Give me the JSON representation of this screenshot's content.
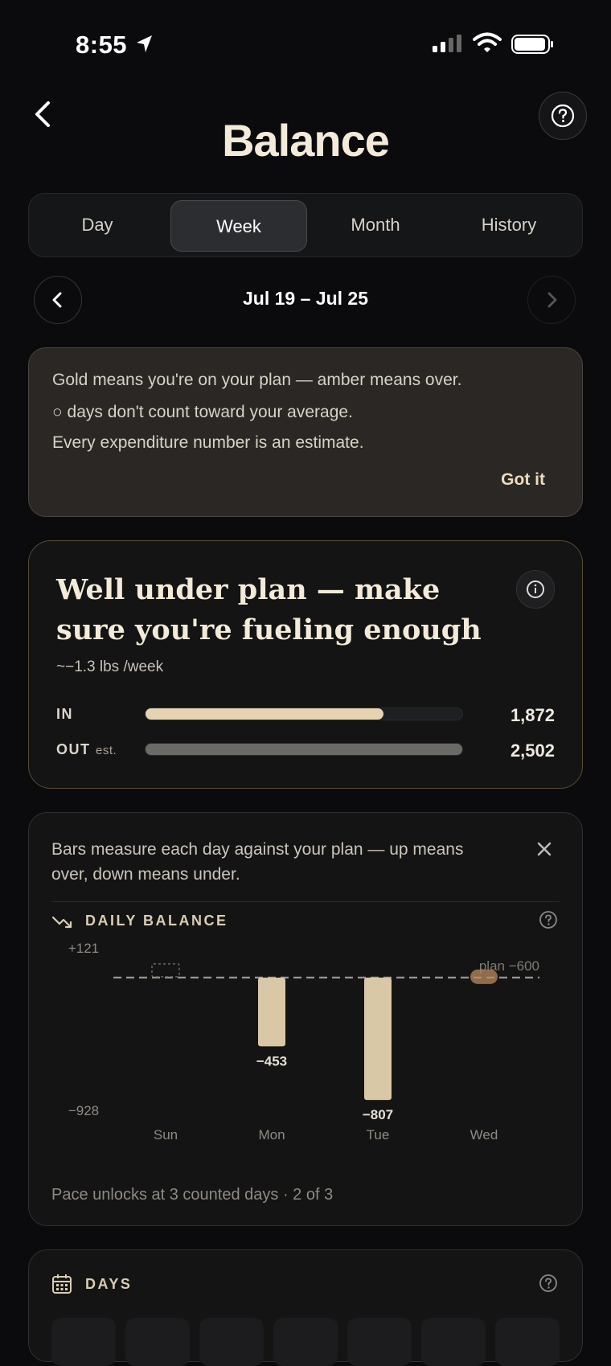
{
  "status_bar": {
    "time": "8:55"
  },
  "header": {
    "title": "Balance"
  },
  "tabs": [
    {
      "label": "Day",
      "active": false
    },
    {
      "label": "Week",
      "active": true
    },
    {
      "label": "Month",
      "active": false
    },
    {
      "label": "History",
      "active": false
    }
  ],
  "date_nav": {
    "range": "Jul 19 – Jul 25"
  },
  "tip": {
    "lines": [
      "Gold means you're on your plan — amber means over.",
      "○ days don't count toward your average.",
      "Every expenditure number is an estimate."
    ],
    "dismiss_label": "Got it"
  },
  "summary": {
    "headline": "Well under plan — make sure you're fueling enough",
    "rate": "~−1.3 lbs /week",
    "in_label": "IN",
    "in_value": "1,872",
    "out_label": "OUT",
    "out_suffix": "est.",
    "out_value": "2,502",
    "in_fraction": 0.75,
    "out_fraction": 1.0
  },
  "daily_balance": {
    "description": "Bars measure each day against your plan — up means over, down means under.",
    "title": "DAILY BALANCE",
    "pace_note": "Pace unlocks at 3 counted days · 2 of 3"
  },
  "chart_data": {
    "type": "bar",
    "categories": [
      "Sun",
      "Mon",
      "Tue",
      "Wed"
    ],
    "values": [
      null,
      -453,
      -807,
      null
    ],
    "value_labels": [
      "",
      "−453",
      "−807",
      ""
    ],
    "y_max_label": "+121",
    "y_min_label": "−928",
    "ylim": [
      -928,
      121
    ],
    "baseline_label": "plan −600",
    "counted": [
      false,
      true,
      true,
      false
    ],
    "colors": {
      "bar": "#d9c8a6",
      "pending": "#b98a5e",
      "baseline": "#9a9690"
    }
  },
  "days_section": {
    "title": "DAYS"
  }
}
